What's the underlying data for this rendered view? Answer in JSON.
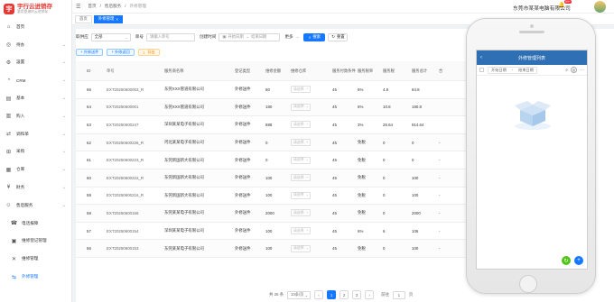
{
  "brand": {
    "title": "宇行云进销存",
    "subtitle": "要用靠谱的云进销存",
    "mark": "宇"
  },
  "sidebar": {
    "items": [
      {
        "label": "首页",
        "icon": "home-icon",
        "glyph": "⌂",
        "chevron": false
      },
      {
        "label": "待办",
        "icon": "todo-icon",
        "glyph": "◎",
        "chevron": true
      },
      {
        "label": "設置",
        "icon": "settings-icon",
        "glyph": "⚙",
        "chevron": true
      },
      {
        "label": "CRM",
        "icon": "crm-icon",
        "glyph": "◔",
        "chevron": true
      },
      {
        "label": "基本",
        "icon": "basic-icon",
        "glyph": "▤",
        "chevron": true
      },
      {
        "label": "购入",
        "icon": "purchase-icon",
        "glyph": "▥",
        "chevron": true
      },
      {
        "label": "调和单",
        "icon": "adjust-icon",
        "glyph": "⇄",
        "chevron": true
      },
      {
        "label": "采购",
        "icon": "procure-icon",
        "glyph": "⊞",
        "chevron": true
      },
      {
        "label": "仓库",
        "icon": "warehouse-icon",
        "glyph": "▦",
        "chevron": true
      },
      {
        "label": "財务",
        "icon": "finance-icon",
        "glyph": "¥",
        "chevron": true
      },
      {
        "label": "售后服务",
        "icon": "service-icon",
        "glyph": "☺",
        "chevron": true
      }
    ],
    "subitems": [
      {
        "label": "电话报障",
        "icon": "phone-icon",
        "glyph": "☎"
      },
      {
        "label": "维修登记管理",
        "icon": "register-icon",
        "glyph": "▣"
      },
      {
        "label": "维修管理",
        "icon": "wrench-icon",
        "glyph": "✕"
      },
      {
        "label": "外修管理",
        "icon": "outsource-icon",
        "glyph": "⇆"
      }
    ]
  },
  "topbar": {
    "breadcrumb": [
      "首页",
      "/",
      "售后服务",
      "/",
      "外修管理"
    ],
    "company": "东莞市某某电脑有限公司",
    "notif_count": "99+"
  },
  "tabs": [
    {
      "label": "首页",
      "active": false
    },
    {
      "label": "外修管理",
      "active": true
    }
  ],
  "filters": {
    "supplier_label": "取供应",
    "supplier_value": "全部",
    "number_label": "单号",
    "number_placeholder": "请输入单号",
    "date_label": "创建时间",
    "start_placeholder": "开始日期",
    "date_sep": "~",
    "end_placeholder": "结束日期",
    "more_label": "更多",
    "search_label": "搜索",
    "reset_label": "重置"
  },
  "actions": {
    "add": "+ 外修送件",
    "return": "+ 外修返回",
    "export": "导出"
  },
  "table": {
    "columns": [
      "ID",
      "单号",
      "服务商名称",
      "登记类型",
      "维修金额",
      "维修仓库",
      "服务付款条件",
      "服务税率",
      "服务税",
      "服务总计",
      "合"
    ],
    "warehouse_placeholder": "请选择",
    "rows": [
      [
        "65",
        "EXT20250600003_R",
        "东莞XXX管道有限公司",
        "外修送件",
        "80",
        "45",
        "6%",
        "4.8",
        "84.8",
        ""
      ],
      [
        "64",
        "EXT20250600001",
        "东莞XXX管道有限公司",
        "外修送件",
        "180",
        "45",
        "6%",
        "10.8",
        "190.8",
        ""
      ],
      [
        "63",
        "EXT20250600247",
        "深圳某某电子有限公司",
        "外修送件",
        "888",
        "45",
        "3%",
        "26.64",
        "914.64",
        ""
      ],
      [
        "62",
        "EXT20250600226_R",
        "河北某某电子有限公司",
        "外修送件",
        "0",
        "45",
        "免税",
        "0",
        "0",
        "-"
      ],
      [
        "61",
        "EXT20250600223_R",
        "东莞新国新大有限公司",
        "外修送件",
        "0",
        "45",
        "免税",
        "0",
        "0",
        "-"
      ],
      [
        "60",
        "EXT20250600222_R",
        "东莞新国新大有限公司",
        "外修送件",
        "100",
        "45",
        "免税",
        "0",
        "100",
        "-"
      ],
      [
        "59",
        "EXT20250600216_R",
        "东莞新国新大有限公司",
        "外修送件",
        "100",
        "45",
        "免税",
        "0",
        "100",
        "-"
      ],
      [
        "58",
        "EXT20250600156",
        "东莞某某电子有限公司",
        "外修送件",
        "2000",
        "45",
        "免税",
        "0",
        "2000",
        "-"
      ],
      [
        "57",
        "EXT20250600154",
        "深圳某某电子有限公司",
        "外修送件",
        "100",
        "45",
        "6%",
        "6",
        "106",
        "-"
      ],
      [
        "56",
        "EXT20250600153",
        "东莞某某电子有限公司",
        "外修送件",
        "100",
        "45",
        "免税",
        "0",
        "100",
        "-"
      ]
    ]
  },
  "pager": {
    "total": "共 25 条",
    "size": "10条/页",
    "pages": [
      "1",
      "2",
      "3"
    ],
    "active_page": "1",
    "goto_label": "前往",
    "goto_value": "1",
    "page_suffix": "页"
  },
  "mobile": {
    "title": "外修管理列表",
    "start_date": "开始日期",
    "sep": "-",
    "end_date": "结束日期"
  }
}
